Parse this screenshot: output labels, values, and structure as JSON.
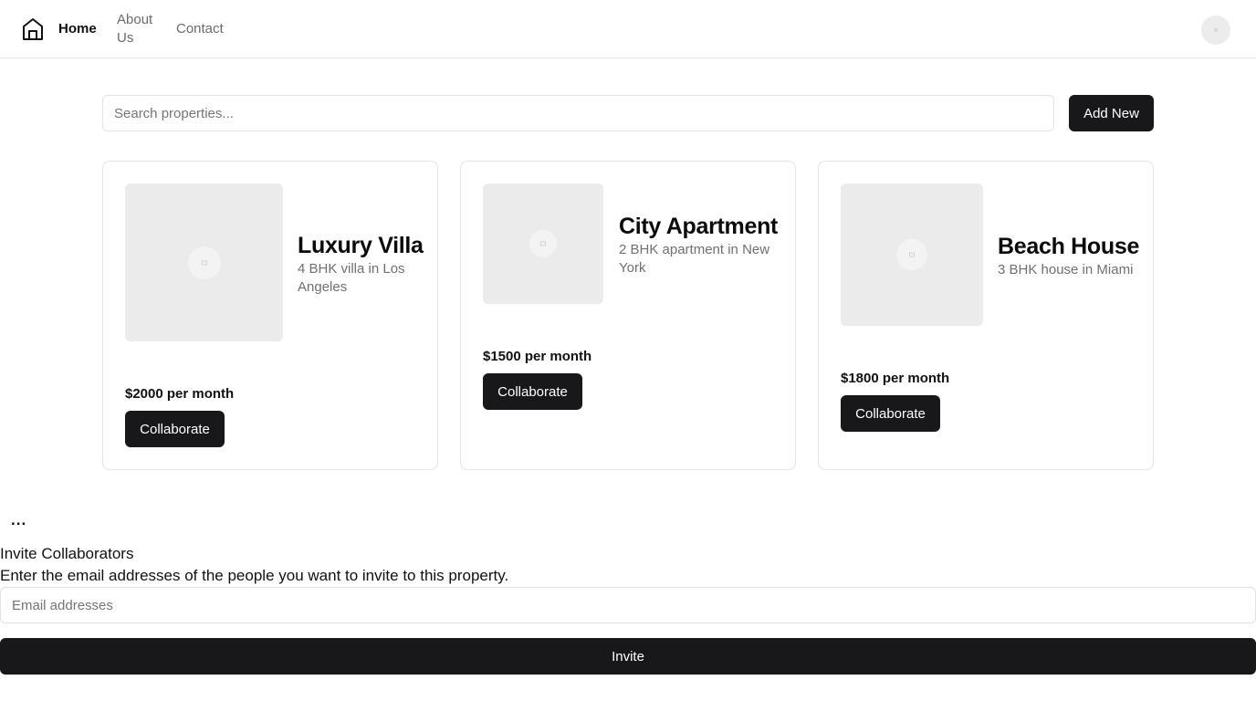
{
  "header": {
    "home_icon": "home-icon",
    "nav": [
      {
        "label": "Home",
        "active": true
      },
      {
        "label": "About Us",
        "active": false
      },
      {
        "label": "Contact",
        "active": false
      }
    ],
    "avatar": "avatar"
  },
  "toolbar": {
    "search_placeholder": "Search properties...",
    "add_new_label": "Add New"
  },
  "properties": [
    {
      "title": "Luxury Villa",
      "description": "4 BHK villa in Los Angeles",
      "price": "$2000 per month",
      "action_label": "Collaborate",
      "image_icon": "image-placeholder-icon"
    },
    {
      "title": "City Apartment",
      "description": "2 BHK apartment in New York",
      "price": "$1500 per month",
      "action_label": "Collaborate",
      "image_icon": "image-placeholder-icon"
    },
    {
      "title": "Beach House",
      "description": "3 BHK house in Miami",
      "price": "$1800 per month",
      "action_label": "Collaborate",
      "image_icon": "image-placeholder-icon"
    }
  ],
  "invite": {
    "menu_label": "...",
    "title": "Invite Collaborators",
    "description": "Enter the email addresses of the people you want to invite to this property.",
    "email_placeholder": "Email addresses",
    "submit_label": "Invite"
  },
  "colors": {
    "primary": "#18181b",
    "muted_text": "#707070",
    "border": "#e4e4e4",
    "placeholder_bg": "#ebebeb"
  }
}
